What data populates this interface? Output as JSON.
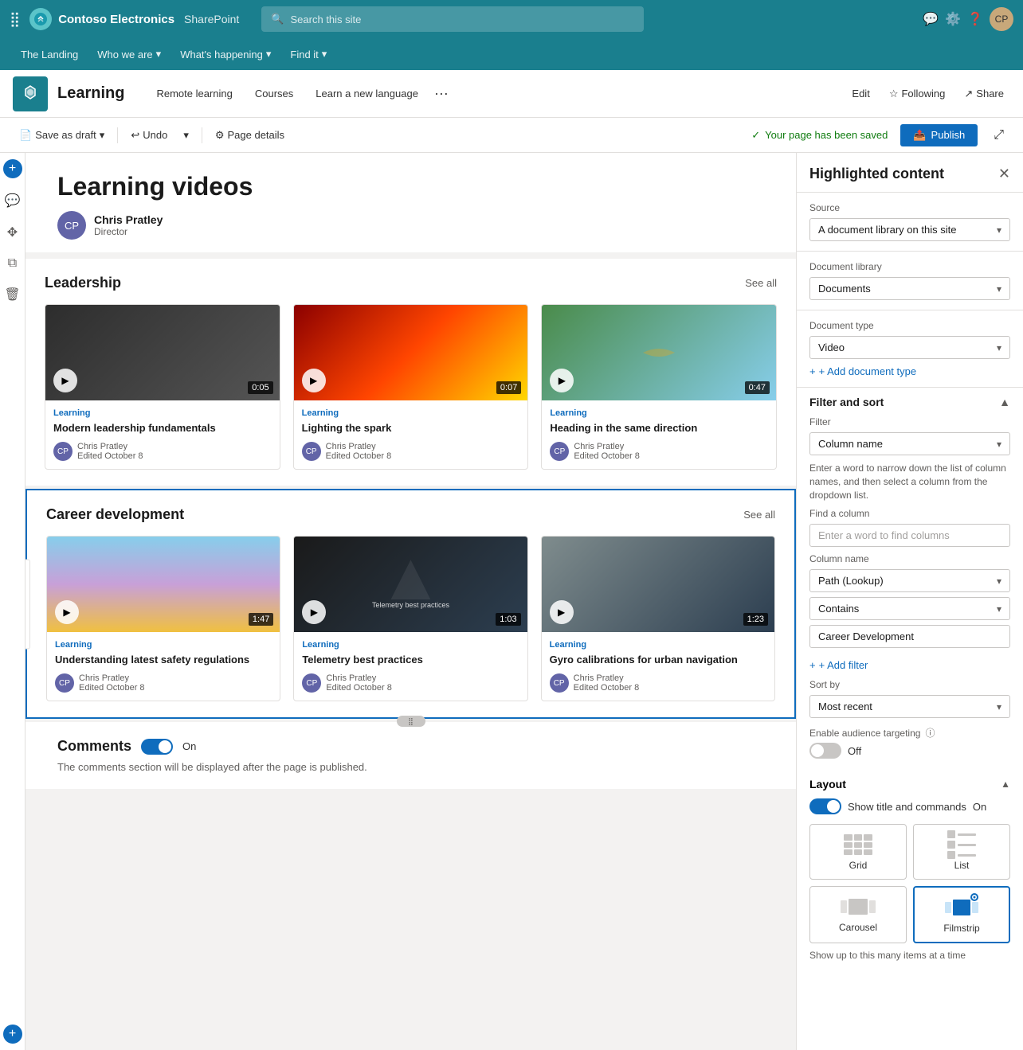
{
  "topNav": {
    "brand": "Contoso Electronics",
    "product": "SharePoint",
    "search_placeholder": "Search this site"
  },
  "subNav": {
    "items": [
      {
        "label": "The Landing"
      },
      {
        "label": "Who we are",
        "hasDropdown": true
      },
      {
        "label": "What's happening",
        "hasDropdown": true
      },
      {
        "label": "Find it",
        "hasDropdown": true
      }
    ]
  },
  "pageHeader": {
    "title": "Learning",
    "navItems": [
      "Remote learning",
      "Courses",
      "Learn a new language"
    ],
    "editLabel": "Edit",
    "followLabel": "Following",
    "shareLabel": "Share"
  },
  "editToolbar": {
    "saveAsDraft": "Save as draft",
    "undo": "Undo",
    "pageDetails": "Page details",
    "savedStatus": "Your page has been saved",
    "publishLabel": "Publish",
    "expandLabel": "⤢"
  },
  "heroSection": {
    "title": "Learning videos",
    "authorName": "Chris Pratley",
    "authorTitle": "Director"
  },
  "leadershipSection": {
    "title": "Leadership",
    "seeAll": "See all",
    "videos": [
      {
        "tag": "Learning",
        "title": "Modern leadership fundamentals",
        "duration": "0:05",
        "authorName": "Chris Pratley",
        "authorEdited": "Edited October 8",
        "thumbClass": "thumb-dark"
      },
      {
        "tag": "Learning",
        "title": "Lighting the spark",
        "duration": "0:07",
        "authorName": "Chris Pratley",
        "authorEdited": "Edited October 8",
        "thumbClass": "thumb-fire"
      },
      {
        "tag": "Learning",
        "title": "Heading in the same direction",
        "duration": "0:47",
        "authorName": "Chris Pratley",
        "authorEdited": "Edited October 8",
        "thumbClass": "thumb-office"
      }
    ]
  },
  "careerSection": {
    "title": "Career development",
    "seeAll": "See all",
    "videos": [
      {
        "tag": "Learning",
        "title": "Understanding latest safety regulations",
        "duration": "1:47",
        "authorName": "Chris Pratley",
        "authorEdited": "Edited October 8",
        "thumbClass": "thumb-drone"
      },
      {
        "tag": "Learning",
        "title": "Telemetry best practices",
        "duration": "1:03",
        "authorName": "Chris Pratley",
        "authorEdited": "Edited October 8",
        "thumbClass": "thumb-tech"
      },
      {
        "tag": "Learning",
        "title": "Gyro calibrations for urban navigation",
        "duration": "1:23",
        "authorName": "Chris Pratley",
        "authorEdited": "Edited October 8",
        "thumbClass": "thumb-city"
      }
    ]
  },
  "commentsSection": {
    "label": "Comments",
    "toggleState": "On",
    "description": "The comments section will be displayed after the page is published."
  },
  "rightPanel": {
    "title": "Highlighted content",
    "source": {
      "label": "Source",
      "value": "A document library on this site"
    },
    "docLibrary": {
      "label": "Document library",
      "value": "Documents"
    },
    "docType": {
      "label": "Document type",
      "value": "Video"
    },
    "addDocType": "+ Add document type",
    "filterSort": {
      "title": "Filter and sort",
      "filter": {
        "label": "Filter",
        "value": "Column name"
      },
      "hint": "Enter a word to narrow down the list of column names, and then select a column from the dropdown list.",
      "findColumn": {
        "label": "Find a column",
        "placeholder": "Enter a word to find columns"
      },
      "columnName": {
        "label": "Column name",
        "value": "Path (Lookup)"
      },
      "contains": {
        "value": "Contains"
      },
      "filterValue": "Career Development",
      "addFilter": "+ Add filter",
      "sortBy": {
        "label": "Sort by",
        "value": "Most recent"
      },
      "audienceTargeting": {
        "label": "Enable audience targeting",
        "state": "Off"
      }
    },
    "layout": {
      "title": "Layout",
      "showTitleCommands": {
        "label": "Show title and commands",
        "state": "On"
      },
      "options": [
        {
          "id": "grid",
          "label": "Grid",
          "selected": false
        },
        {
          "id": "list",
          "label": "List",
          "selected": false
        },
        {
          "id": "carousel",
          "label": "Carousel",
          "selected": false
        },
        {
          "id": "filmstrip",
          "label": "Filmstrip",
          "selected": true
        }
      ],
      "bottomText": "Show up to this many items at a time"
    }
  }
}
